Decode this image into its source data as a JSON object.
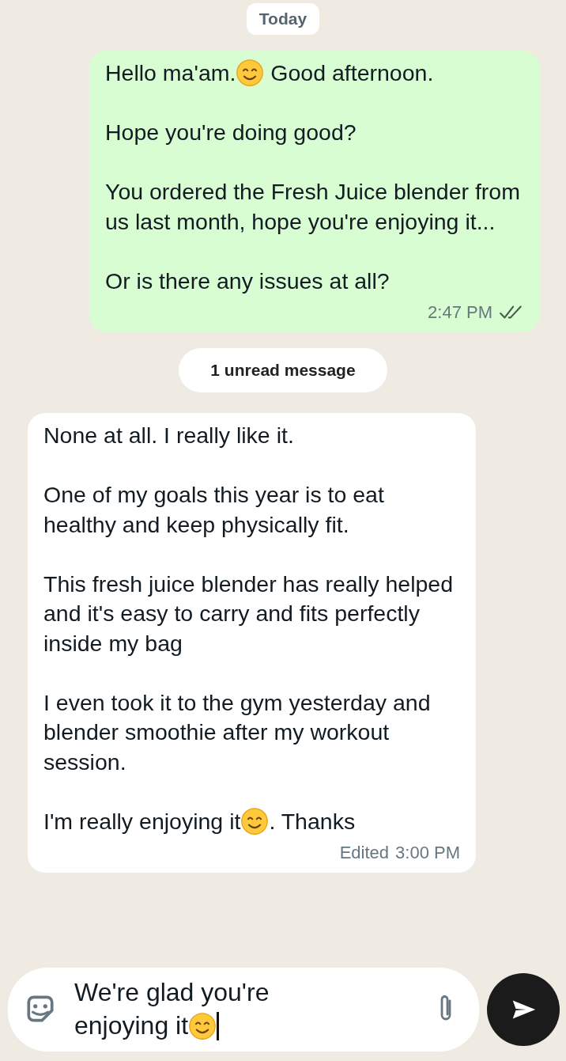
{
  "date_chip": "Today",
  "messages": [
    {
      "kind": "outgoing",
      "paragraphs": [
        [
          {
            "kind": "text",
            "text": "Hello ma'am."
          },
          {
            "kind": "emoji"
          },
          {
            "kind": "text",
            "text": " Good afternoon."
          }
        ],
        [
          {
            "kind": "text",
            "text": "Hope you're doing good?"
          }
        ],
        [
          {
            "kind": "text",
            "text": "You ordered the Fresh Juice blender from us last month, hope you're enjoying it..."
          }
        ],
        [
          {
            "kind": "text",
            "text": "Or is there  any issues at all?"
          }
        ]
      ],
      "time": "2:47 PM",
      "read": false
    },
    {
      "kind": "unread_chip",
      "text": "1 unread message"
    },
    {
      "kind": "incoming",
      "paragraphs": [
        [
          {
            "kind": "text",
            "text": "None at all. I really like it."
          }
        ],
        [
          {
            "kind": "text",
            "text": "One of my goals this year is to eat healthy and keep physically fit."
          }
        ],
        [
          {
            "kind": "text",
            "text": "This fresh juice blender has really helped and it's easy to carry and fits perfectly inside my bag"
          }
        ],
        [
          {
            "kind": "text",
            "text": "I even took it to the gym yesterday and blender smoothie after my workout session."
          }
        ],
        [
          {
            "kind": "text",
            "text": "I'm really enjoying it"
          },
          {
            "kind": "emoji"
          },
          {
            "kind": "text",
            "text": ". Thanks"
          }
        ]
      ],
      "edited_label": "Edited",
      "time": "3:00 PM"
    }
  ],
  "composer": {
    "value": [
      {
        "kind": "text",
        "text": "We're glad you're enjoying it"
      },
      {
        "kind": "emoji"
      }
    ]
  }
}
